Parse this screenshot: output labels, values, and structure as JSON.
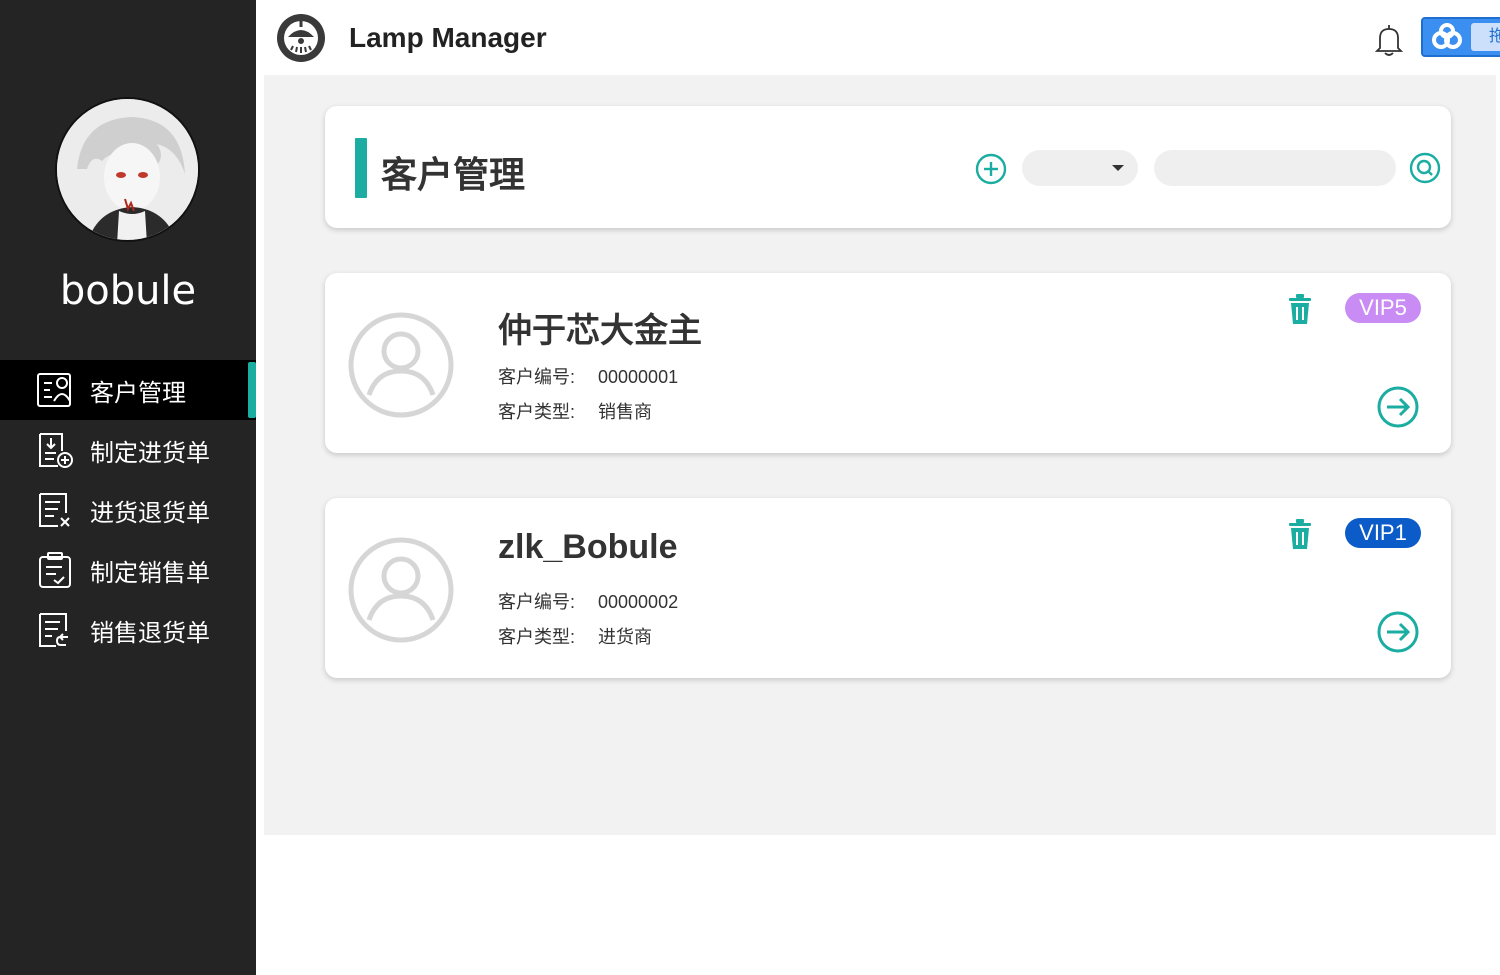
{
  "sidebar": {
    "username": "bobule",
    "items": [
      {
        "label": "客户管理",
        "icon": "customer-icon",
        "active": true
      },
      {
        "label": "制定进货单",
        "icon": "purchase-add-icon",
        "active": false
      },
      {
        "label": "进货退货单",
        "icon": "purchase-return-icon",
        "active": false
      },
      {
        "label": "制定销售单",
        "icon": "sale-order-icon",
        "active": false
      },
      {
        "label": "销售退货单",
        "icon": "sale-return-icon",
        "active": false
      }
    ]
  },
  "header": {
    "title": "Lamp Manager",
    "cloud_tag": "拖"
  },
  "page": {
    "title": "客户管理",
    "search_placeholder": "",
    "select_value": ""
  },
  "customers": [
    {
      "name": "仲于芯大金主",
      "id_label": "客户编号:",
      "id": "00000001",
      "type_label": "客户类型:",
      "type": "销售商",
      "vip": "VIP5",
      "vip_color": "#c98cf4"
    },
    {
      "name": "zlk_Bobule",
      "id_label": "客户编号:",
      "id": "00000002",
      "type_label": "客户类型:",
      "type": "进货商",
      "vip": "VIP1",
      "vip_color": "#0b5cc9"
    }
  ],
  "colors": {
    "accent": "#1bada2",
    "sidebar_bg": "#242424"
  }
}
